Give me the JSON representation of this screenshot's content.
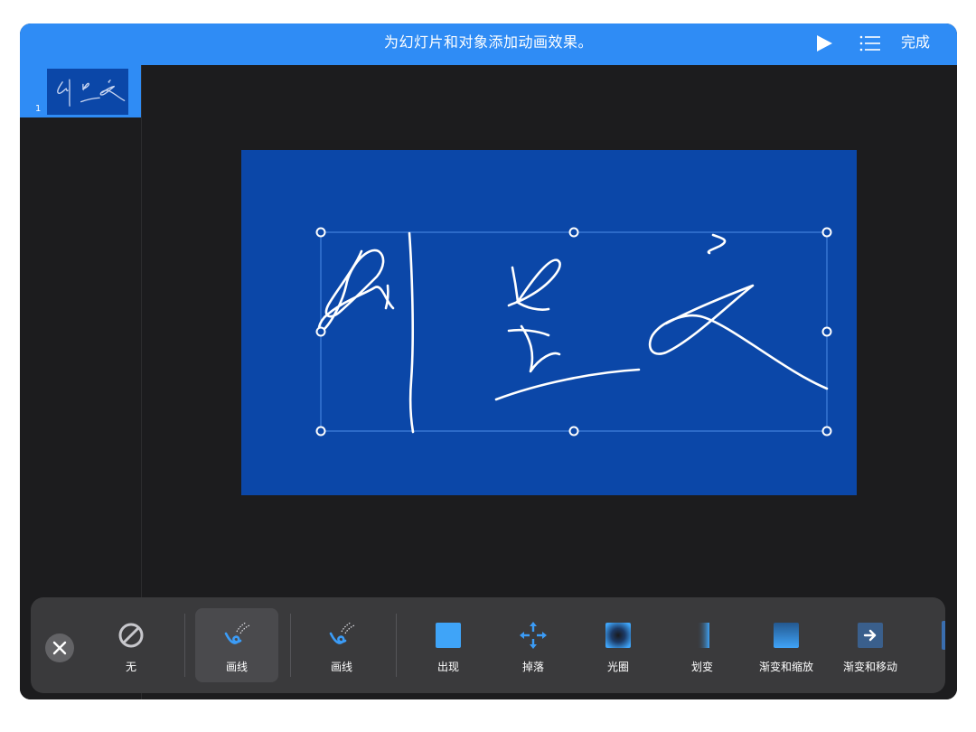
{
  "header": {
    "title": "为幻灯片和对象添加动画效果。",
    "done_label": "完成",
    "play_icon": "play-icon",
    "list_icon": "list-icon"
  },
  "sidebar": {
    "slides": [
      {
        "number": "1"
      }
    ]
  },
  "colors": {
    "accent": "#2f8cf5",
    "slide_background": "#0b47a8",
    "dark_background": "#1c1c1e",
    "bar_background": "#3a3a3c"
  },
  "animations": {
    "close_icon": "close-icon",
    "items": [
      {
        "id": "none",
        "label": "无",
        "icon": "prohibited-icon"
      },
      {
        "id": "draw-line-1",
        "label": "画线",
        "icon": "draw-line-icon",
        "selected": true
      },
      {
        "id": "draw-line-2",
        "label": "画线",
        "icon": "draw-line-icon"
      },
      {
        "id": "appear",
        "label": "出现",
        "icon": "appear-icon"
      },
      {
        "id": "drop",
        "label": "掉落",
        "icon": "drop-arrows-icon"
      },
      {
        "id": "iris",
        "label": "光圈",
        "icon": "iris-icon"
      },
      {
        "id": "wipe",
        "label": "划变",
        "icon": "wipe-icon"
      },
      {
        "id": "fade-scale",
        "label": "渐变和缩放",
        "icon": "fade-scale-icon"
      },
      {
        "id": "fade-move",
        "label": "渐变和移动",
        "icon": "fade-move-icon"
      }
    ]
  }
}
